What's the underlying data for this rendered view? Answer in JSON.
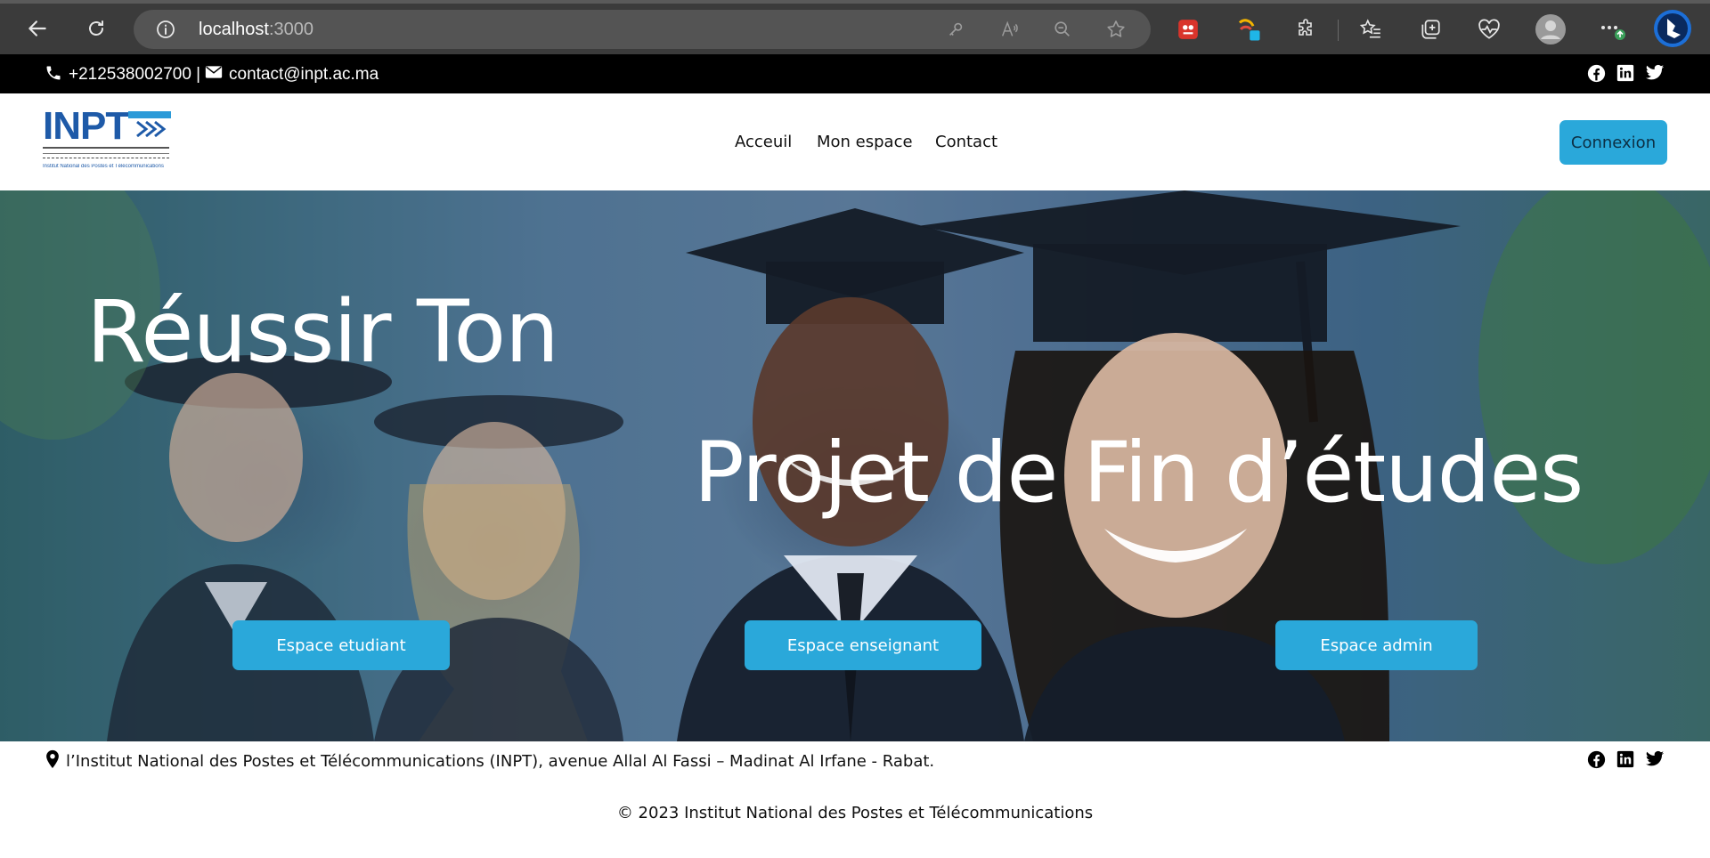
{
  "browser": {
    "url_host": "localhost",
    "url_port": ":3000",
    "icons": [
      "back-icon",
      "refresh-icon",
      "site-info-icon",
      "key-icon",
      "read-aloud-icon",
      "zoom-out-icon",
      "favorite-star-icon",
      "extension-red-icon",
      "extension-colorful-icon",
      "extensions-puzzle-icon",
      "favorites-icon",
      "collections-icon",
      "performance-icon",
      "profile-icon",
      "more-icon",
      "bing-copilot-icon"
    ]
  },
  "topbar": {
    "phone": "+212538002700 |",
    "email": "contact@inpt.ac.ma",
    "social": [
      "facebook-icon",
      "linkedin-icon",
      "twitter-icon"
    ]
  },
  "header": {
    "logo_text": "INPT",
    "logo_subtitle": "Institut National des Postes et Télécommunications",
    "nav": [
      "Acceuil",
      "Mon espace",
      "Contact"
    ],
    "connexion_label": "Connexion",
    "accent_color": "#2aa8da"
  },
  "hero": {
    "title_line1": "Réussir Ton",
    "title_line2": "Projet de Fin d’études",
    "buttons": [
      "Espace etudiant",
      "Espace enseignant",
      "Espace admin"
    ]
  },
  "footer": {
    "address": "l’Institut National des Postes et Télécommunications (INPT), avenue Allal Al Fassi – Madinat Al Irfane - Rabat.",
    "copyright": "© 2023 Institut National des Postes et Télécommunications",
    "social": [
      "facebook-icon",
      "linkedin-icon",
      "twitter-icon"
    ]
  }
}
